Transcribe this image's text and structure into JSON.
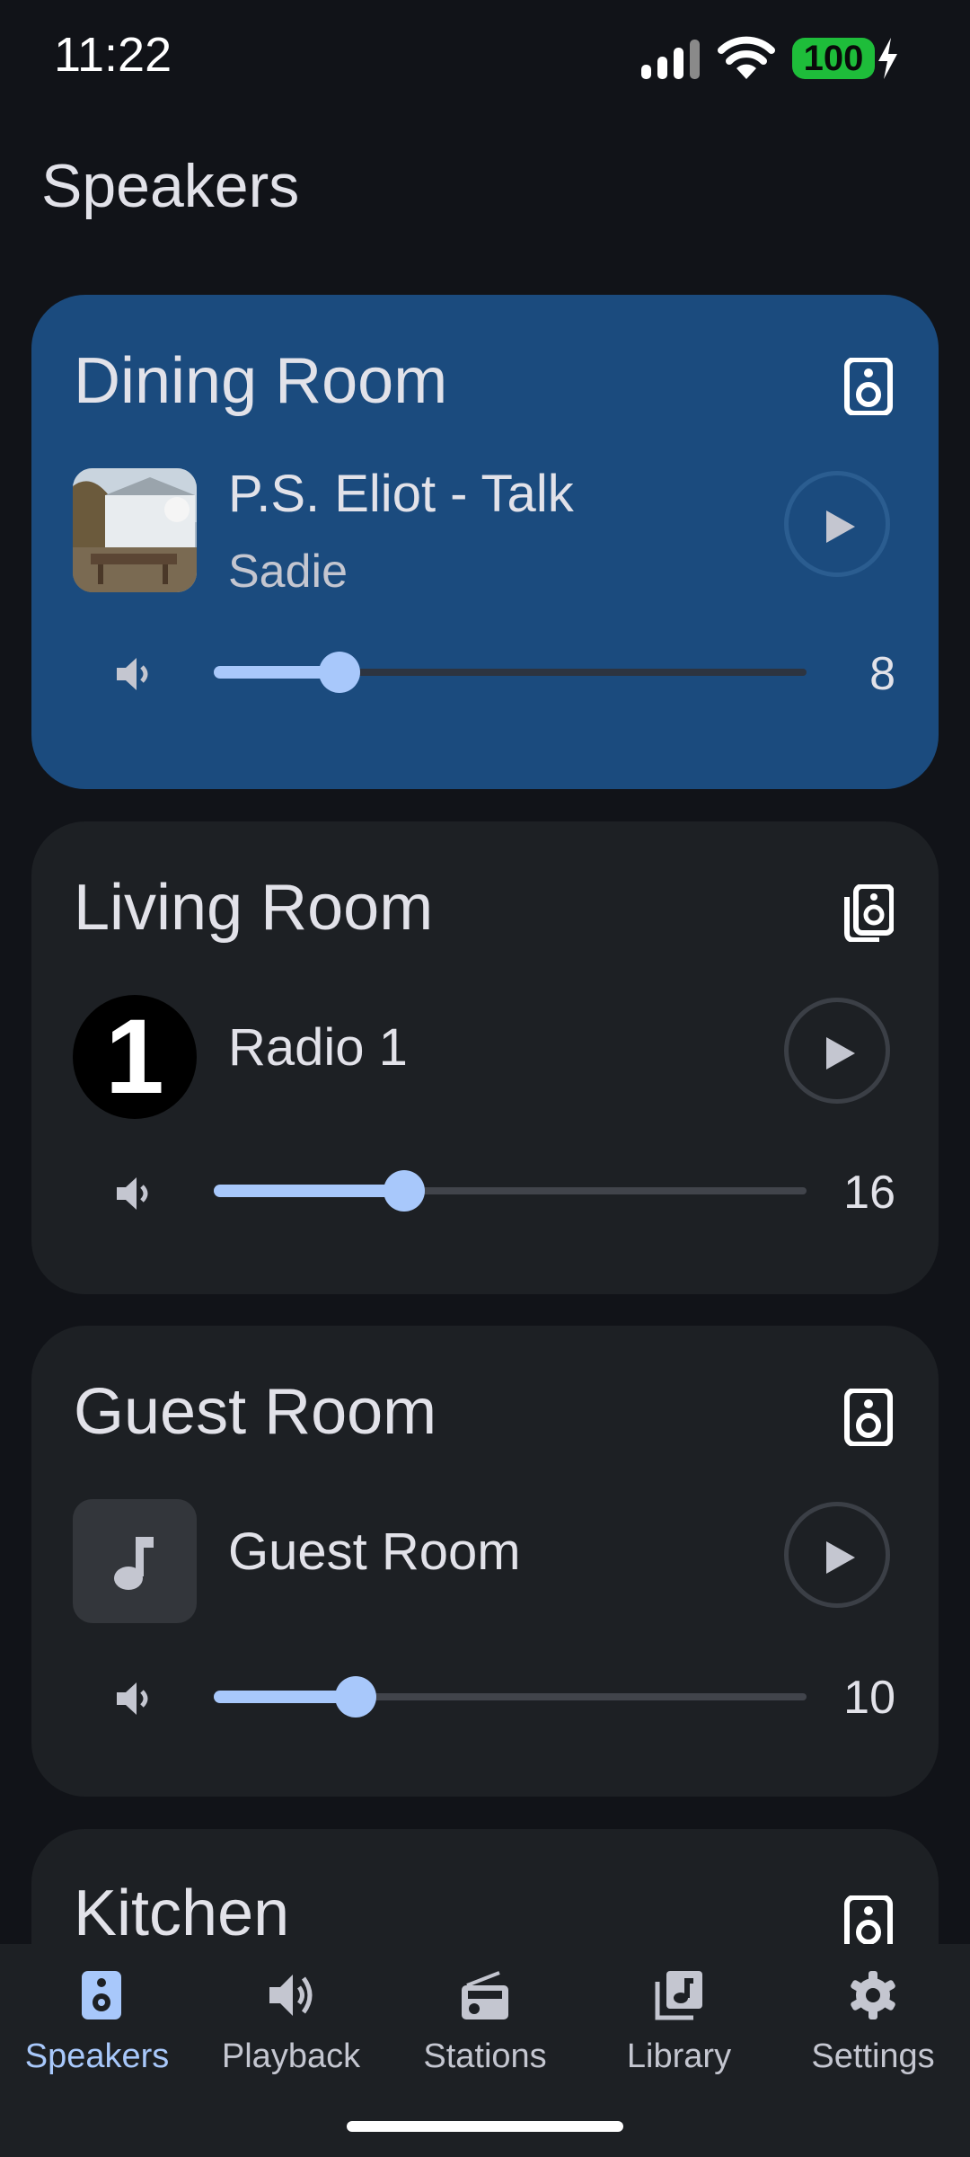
{
  "status_bar": {
    "time": "11:22",
    "battery": "100"
  },
  "page": {
    "title": "Speakers"
  },
  "cards": [
    {
      "room": "Dining Room",
      "track": "P.S. Eliot - Talk",
      "artist": "Sadie",
      "volume": "8",
      "volume_level": 0.21,
      "icon": "speaker-icon",
      "art": "album-art"
    },
    {
      "room": "Living Room",
      "track": "Radio 1",
      "volume": "16",
      "volume_level": 0.32,
      "icon": "speaker-group-icon",
      "art": "radio-1-logo",
      "logo_text": "1"
    },
    {
      "room": "Guest Room",
      "track": "Guest Room",
      "volume": "10",
      "volume_level": 0.24,
      "icon": "speaker-icon",
      "art": "music-note-icon"
    },
    {
      "room": "Kitchen",
      "icon": "speaker-icon"
    }
  ],
  "nav": {
    "items": [
      {
        "label": "Speakers",
        "icon": "speaker-icon",
        "active": true
      },
      {
        "label": "Playback",
        "icon": "volume-icon"
      },
      {
        "label": "Stations",
        "icon": "radio-icon"
      },
      {
        "label": "Library",
        "icon": "library-music-icon"
      },
      {
        "label": "Settings",
        "icon": "gear-icon"
      }
    ]
  },
  "colors": {
    "accent": "#a8c8fb",
    "active_card": "#1b4b7e",
    "card": "#1d2024",
    "background": "#111318",
    "battery": "#1ebd3a"
  }
}
